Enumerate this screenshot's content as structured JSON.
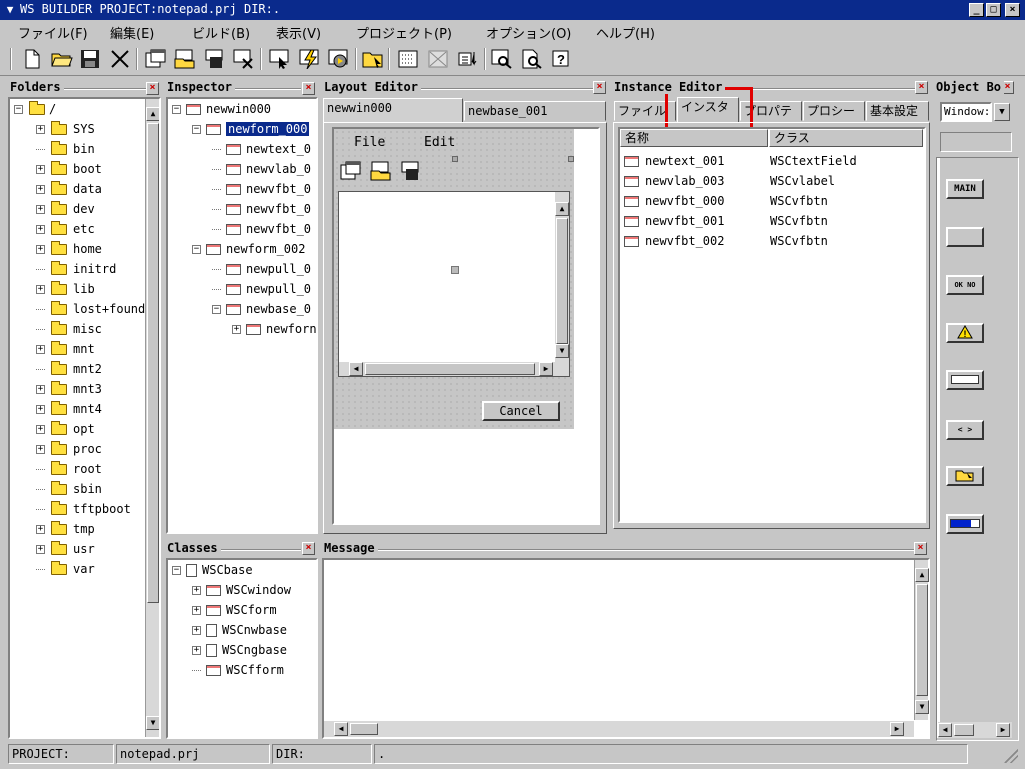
{
  "window": {
    "title": "WS BUILDER PROJECT:notepad.prj DIR:."
  },
  "menu": [
    "ファイル(F)",
    "編集(E)",
    "ビルド(B)",
    "表示(V)",
    "プロジェクト(P)",
    "オプション(O)",
    "ヘルプ(H)"
  ],
  "folders": {
    "title": "Folders",
    "root": "/",
    "items": [
      "SYS",
      "bin",
      "boot",
      "data",
      "dev",
      "etc",
      "home",
      "initrd",
      "lib",
      "lost+found",
      "misc",
      "mnt",
      "mnt2",
      "mnt3",
      "mnt4",
      "opt",
      "proc",
      "root",
      "sbin",
      "tftpboot",
      "tmp",
      "usr",
      "var"
    ]
  },
  "inspector": {
    "title": "Inspector",
    "items": [
      "newwin000",
      "newform_000",
      "newtext_0",
      "newvlab_0",
      "newvfbt_0",
      "newvfbt_0",
      "newvfbt_0",
      "newform_002",
      "newpull_0",
      "newpull_0",
      "newbase_0",
      "newforn"
    ]
  },
  "classes": {
    "title": "Classes",
    "items": [
      "WSCbase",
      "WSCwindow",
      "WSCform",
      "WSCnwbase",
      "WSCngbase",
      "WSCfform"
    ]
  },
  "layout_editor": {
    "title": "Layout Editor",
    "tabs": [
      "newwin000",
      "newbase_001"
    ],
    "menu": [
      "File",
      "Edit"
    ],
    "cancel_label": "Cancel"
  },
  "instance_editor": {
    "title": "Instance Editor",
    "tabs": [
      "ファイル",
      "インスタ",
      "プロパテ",
      "プロシー",
      "基本設定"
    ],
    "columns": [
      "名称",
      "クラス"
    ],
    "rows": [
      {
        "name": "newtext_001",
        "class": "WSCtextField"
      },
      {
        "name": "newvlab_003",
        "class": "WSCvlabel"
      },
      {
        "name": "newvfbt_000",
        "class": "WSCvfbtn"
      },
      {
        "name": "newvfbt_001",
        "class": "WSCvfbtn"
      },
      {
        "name": "newvfbt_002",
        "class": "WSCvfbtn"
      }
    ],
    "highlight_color": "#e00000"
  },
  "object_box": {
    "title": "Object Bo",
    "select_value": "Window:",
    "buttons": [
      "MAIN",
      "",
      "OK NO",
      "!",
      "AAAA",
      "< >",
      "",
      ""
    ]
  },
  "message": {
    "title": "Message"
  },
  "status": {
    "project_label": "PROJECT:",
    "project_value": "notepad.prj",
    "dir_label": "DIR:",
    "dir_value": "."
  }
}
